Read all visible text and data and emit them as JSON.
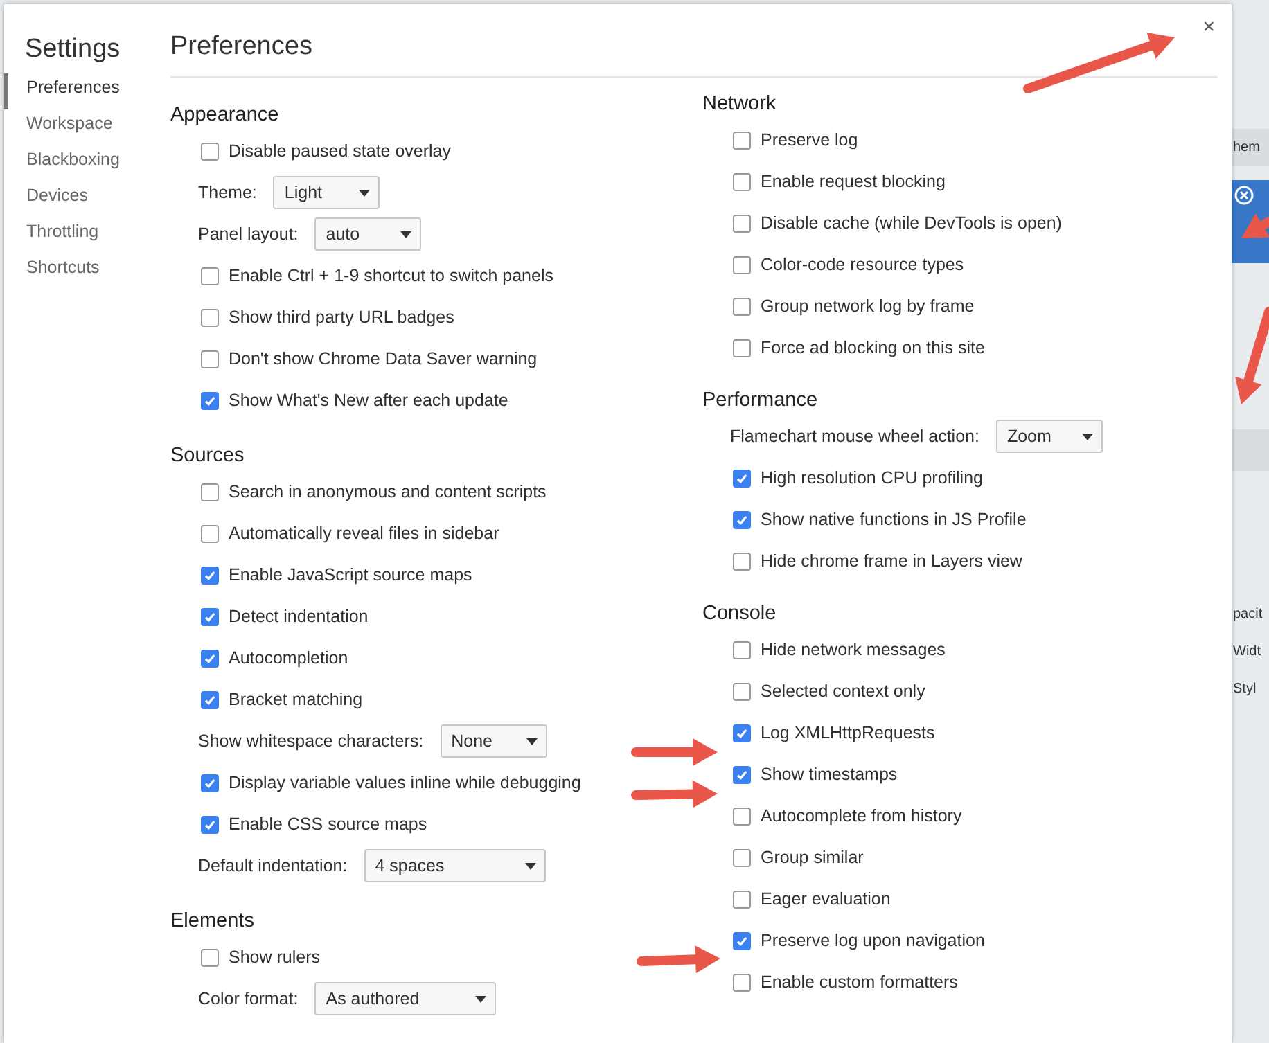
{
  "sidebar": {
    "title": "Settings",
    "items": [
      {
        "label": "Preferences",
        "selected": true
      },
      {
        "label": "Workspace",
        "selected": false
      },
      {
        "label": "Blackboxing",
        "selected": false
      },
      {
        "label": "Devices",
        "selected": false
      },
      {
        "label": "Throttling",
        "selected": false
      },
      {
        "label": "Shortcuts",
        "selected": false
      }
    ]
  },
  "page_title": "Preferences",
  "close": "×",
  "columns": [
    [
      {
        "title": "Appearance",
        "items": [
          {
            "kind": "checkbox",
            "label": "Disable paused state overlay",
            "checked": false
          },
          {
            "kind": "select",
            "label": "Theme:",
            "value": "Light"
          },
          {
            "kind": "select",
            "label": "Panel layout:",
            "value": "auto"
          },
          {
            "kind": "checkbox",
            "label": "Enable Ctrl + 1-9 shortcut to switch panels",
            "checked": false
          },
          {
            "kind": "checkbox",
            "label": "Show third party URL badges",
            "checked": false
          },
          {
            "kind": "checkbox",
            "label": "Don't show Chrome Data Saver warning",
            "checked": false
          },
          {
            "kind": "checkbox",
            "label": "Show What's New after each update",
            "checked": true
          }
        ]
      },
      {
        "title": "Sources",
        "items": [
          {
            "kind": "checkbox",
            "label": "Search in anonymous and content scripts",
            "checked": false
          },
          {
            "kind": "checkbox",
            "label": "Automatically reveal files in sidebar",
            "checked": false
          },
          {
            "kind": "checkbox",
            "label": "Enable JavaScript source maps",
            "checked": true
          },
          {
            "kind": "checkbox",
            "label": "Detect indentation",
            "checked": true
          },
          {
            "kind": "checkbox",
            "label": "Autocompletion",
            "checked": true
          },
          {
            "kind": "checkbox",
            "label": "Bracket matching",
            "checked": true
          },
          {
            "kind": "select",
            "label": "Show whitespace characters:",
            "value": "None"
          },
          {
            "kind": "checkbox",
            "label": "Display variable values inline while debugging",
            "checked": true
          },
          {
            "kind": "checkbox",
            "label": "Enable CSS source maps",
            "checked": true
          },
          {
            "kind": "select",
            "label": "Default indentation:",
            "value": "4 spaces"
          }
        ]
      },
      {
        "title": "Elements",
        "items": [
          {
            "kind": "checkbox",
            "label": "Show rulers",
            "checked": false
          },
          {
            "kind": "select",
            "label": "Color format:",
            "value": "As authored"
          }
        ]
      }
    ],
    [
      {
        "title": "Network",
        "items": [
          {
            "kind": "checkbox",
            "label": "Preserve log",
            "checked": false
          },
          {
            "kind": "checkbox",
            "label": "Enable request blocking",
            "checked": false
          },
          {
            "kind": "checkbox",
            "label": "Disable cache (while DevTools is open)",
            "checked": false
          },
          {
            "kind": "checkbox",
            "label": "Color-code resource types",
            "checked": false
          },
          {
            "kind": "checkbox",
            "label": "Group network log by frame",
            "checked": false
          },
          {
            "kind": "checkbox",
            "label": "Force ad blocking on this site",
            "checked": false
          }
        ]
      },
      {
        "title": "Performance",
        "items": [
          {
            "kind": "select",
            "label": "Flamechart mouse wheel action:",
            "value": "Zoom"
          },
          {
            "kind": "checkbox",
            "label": "High resolution CPU profiling",
            "checked": true
          },
          {
            "kind": "checkbox",
            "label": "Show native functions in JS Profile",
            "checked": true
          },
          {
            "kind": "checkbox",
            "label": "Hide chrome frame in Layers view",
            "checked": false
          }
        ]
      },
      {
        "title": "Console",
        "items": [
          {
            "kind": "checkbox",
            "label": "Hide network messages",
            "checked": false
          },
          {
            "kind": "checkbox",
            "label": "Selected context only",
            "checked": false
          },
          {
            "kind": "checkbox",
            "label": "Log XMLHttpRequests",
            "checked": true
          },
          {
            "kind": "checkbox",
            "label": "Show timestamps",
            "checked": true
          },
          {
            "kind": "checkbox",
            "label": "Autocomplete from history",
            "checked": false
          },
          {
            "kind": "checkbox",
            "label": "Group similar",
            "checked": false
          },
          {
            "kind": "checkbox",
            "label": "Eager evaluation",
            "checked": false
          },
          {
            "kind": "checkbox",
            "label": "Preserve log upon navigation",
            "checked": true
          },
          {
            "kind": "checkbox",
            "label": "Enable custom formatters",
            "checked": false
          }
        ]
      }
    ]
  ],
  "background_texts": [
    "hem",
    "pacit",
    "Widt",
    "Styl"
  ]
}
